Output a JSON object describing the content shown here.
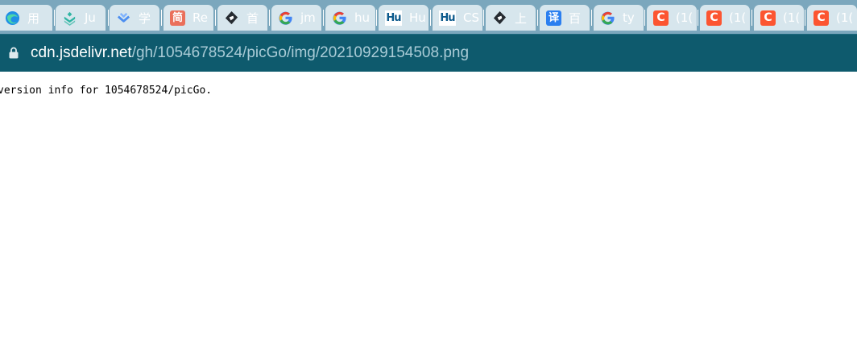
{
  "browser": {
    "tabs": [
      {
        "label": "用",
        "icon": "edge-icon"
      },
      {
        "label": "Ju",
        "icon": "juejin-icon"
      },
      {
        "label": "学",
        "icon": "yuque-icon"
      },
      {
        "label": "Re",
        "icon": "jianshu-icon",
        "icon_text": "简"
      },
      {
        "label": "首",
        "icon": "eagle-icon"
      },
      {
        "label": "jm",
        "icon": "google-icon"
      },
      {
        "label": "hu",
        "icon": "google-icon"
      },
      {
        "label": "Hu",
        "icon": "hu-icon",
        "icon_text": "Hu"
      },
      {
        "label": "CS",
        "icon": "hu-icon",
        "icon_text": "Hu"
      },
      {
        "label": "上",
        "icon": "eagle-icon"
      },
      {
        "label": "百",
        "icon": "translate-icon",
        "icon_text": "译"
      },
      {
        "label": "ty",
        "icon": "google-icon"
      },
      {
        "label": "(1(",
        "icon": "csdn-icon",
        "icon_text": "C"
      },
      {
        "label": "(1(",
        "icon": "csdn-icon",
        "icon_text": "C"
      },
      {
        "label": "(1(",
        "icon": "csdn-icon",
        "icon_text": "C"
      },
      {
        "label": "(1(",
        "icon": "csdn-icon",
        "icon_text": "C"
      }
    ],
    "address_bar": {
      "host": "cdn.jsdelivr.net",
      "path": "/gh/1054678524/picGo/img/20210929154508.png",
      "lock_icon": "lock-icon"
    },
    "colors": {
      "tabstrip": "#7ba7bd",
      "toolbar": "#0e5a6d",
      "csdn": "#fc5531",
      "jianshu": "#ea6f5a"
    }
  },
  "page": {
    "text": "version info for 1054678524/picGo."
  }
}
